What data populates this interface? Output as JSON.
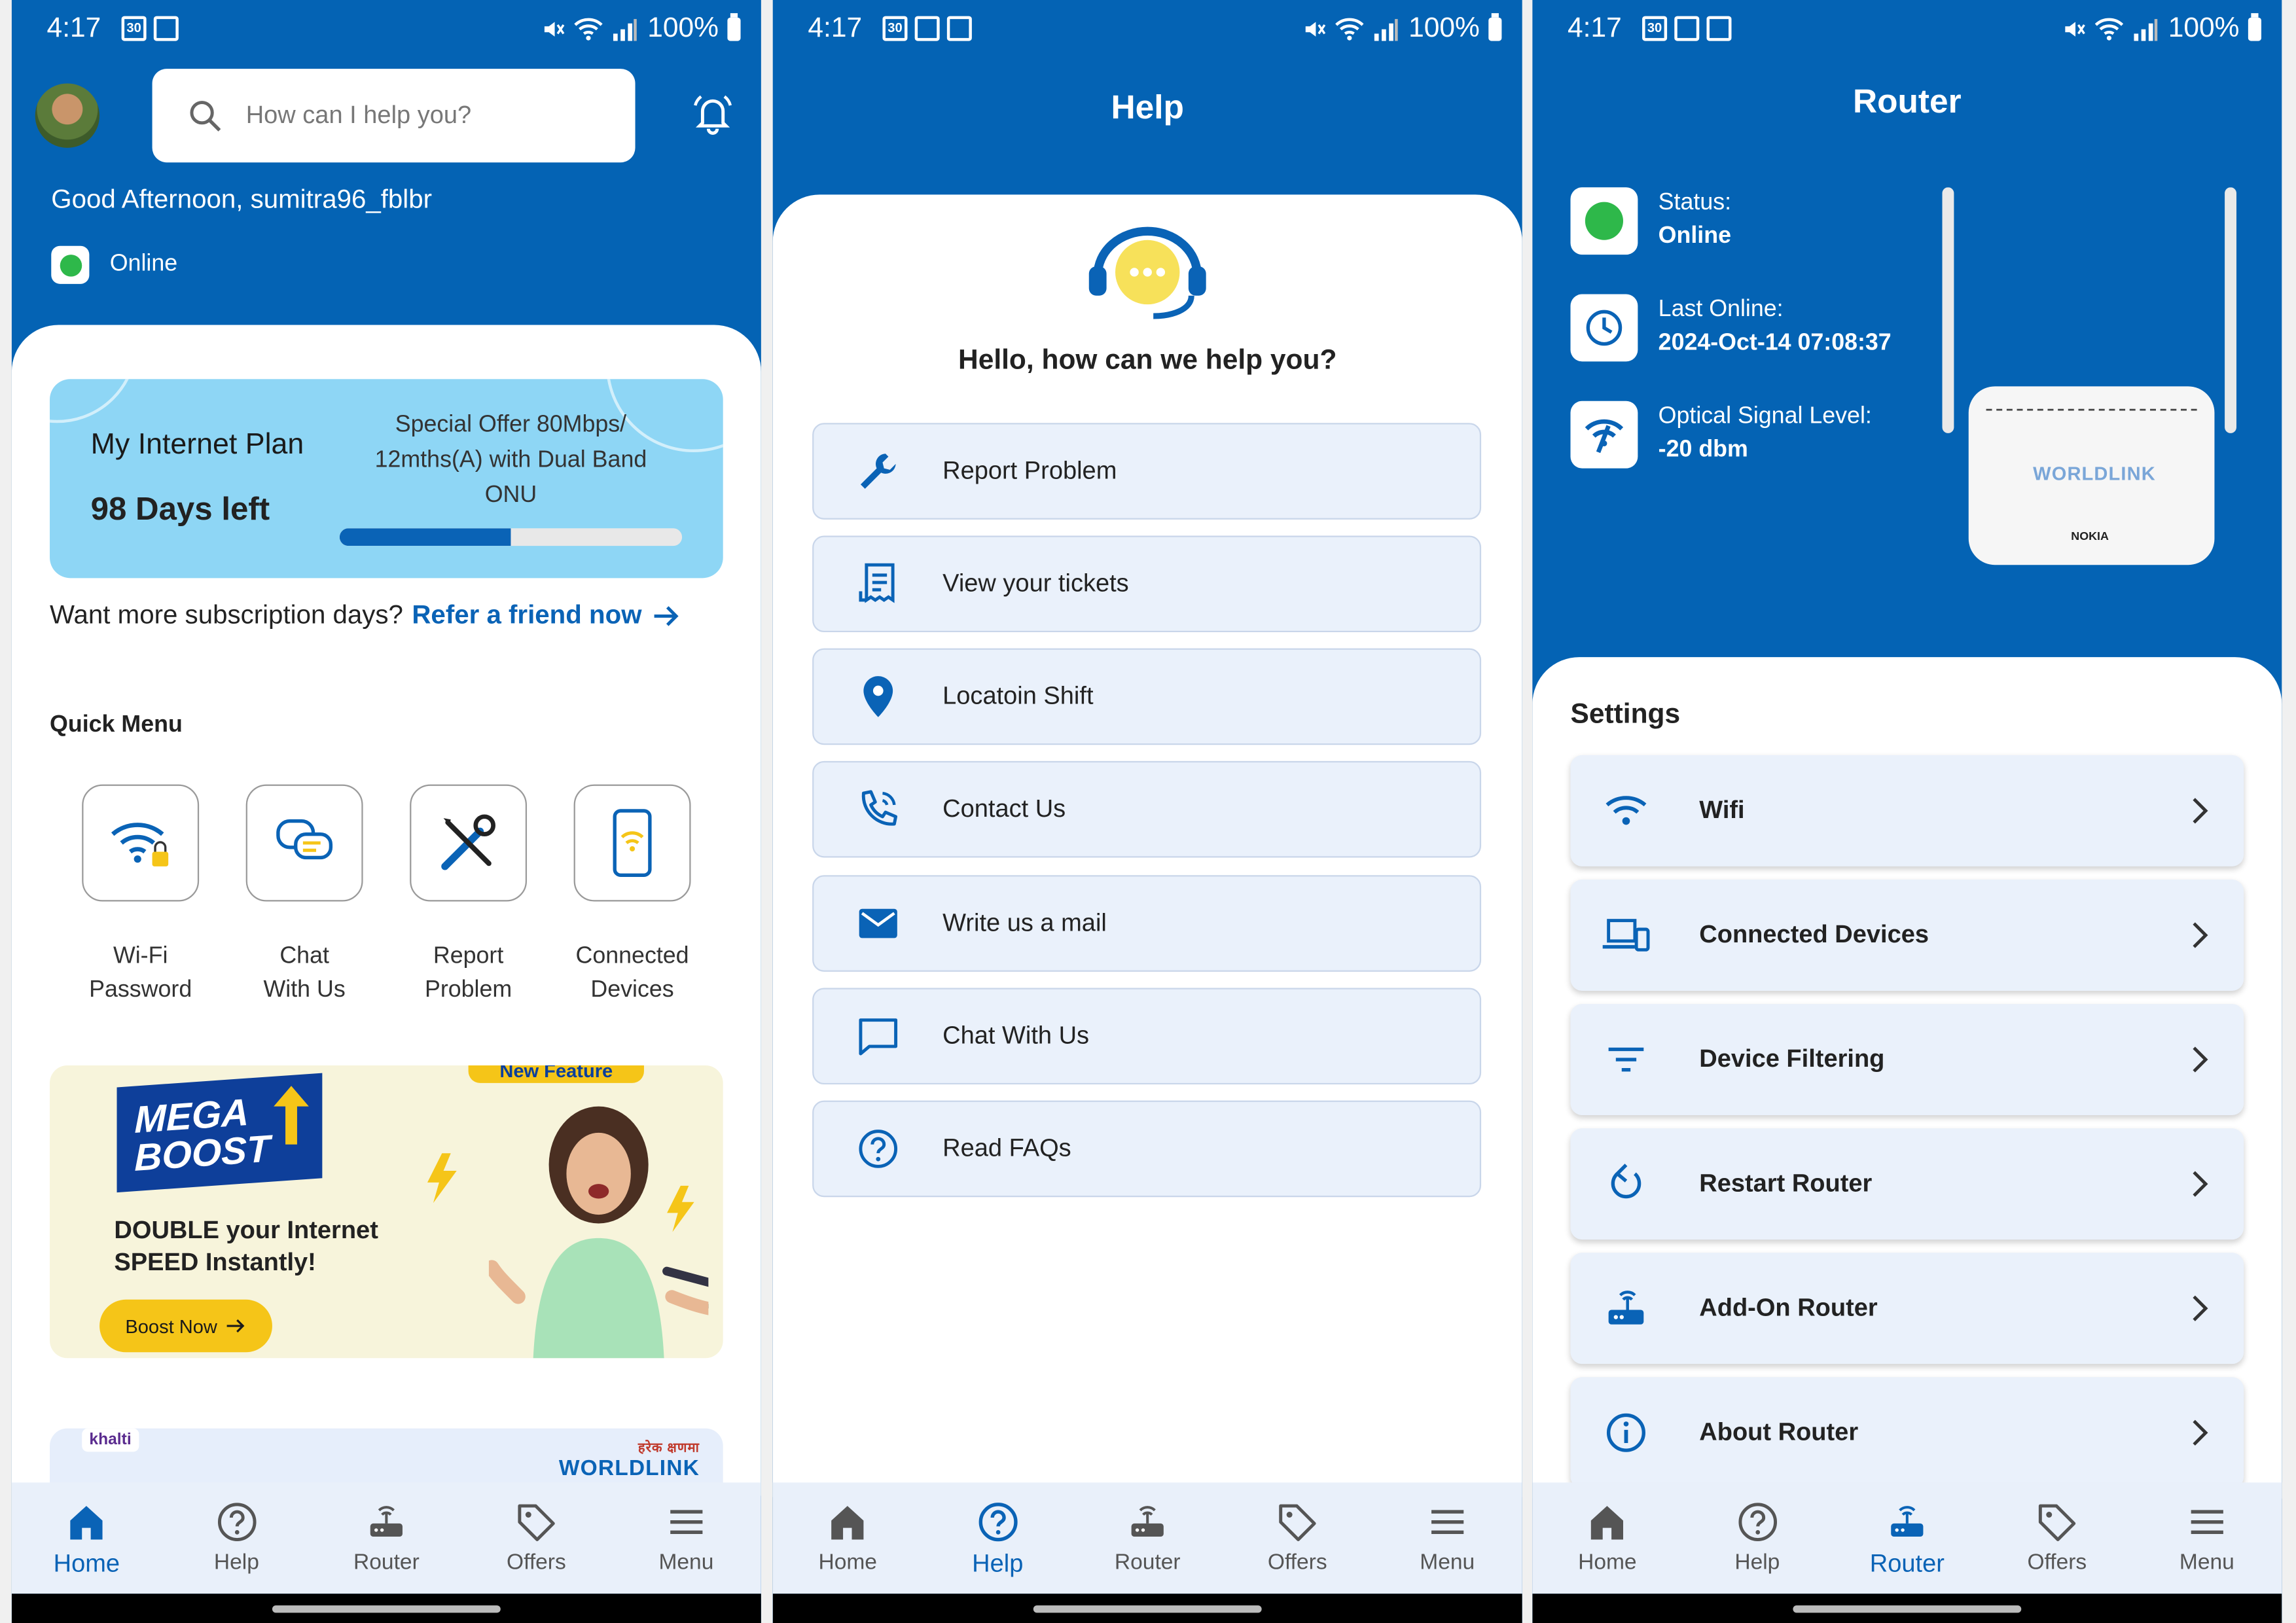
{
  "status_bar": {
    "time": "4:17",
    "battery": "100%",
    "mini_icon_label": "30"
  },
  "colors": {
    "primary": "#0463b4",
    "accent": "#0a63b6",
    "online_dot": "#2eb84a",
    "card_bg": "#eaf1fb",
    "banner_yellow": "#f5c518"
  },
  "home": {
    "search_placeholder": "How can I help you?",
    "greeting": "Good Afternoon, sumitra96_fblbr",
    "status": "Online",
    "plan": {
      "label": "My Internet Plan",
      "days_left": "98 Days left",
      "offer": "Special Offer 80Mbps/ 12mths(A) with Dual Band ONU",
      "progress": 0.5
    },
    "refer_text": "Want more subscription days?",
    "refer_link": "Refer a friend now",
    "quick_menu_title": "Quick Menu",
    "quick_menu": [
      {
        "label_1": "Wi-Fi",
        "label_2": "Password",
        "icon": "wifi-lock-icon"
      },
      {
        "label_1": "Chat",
        "label_2": "With Us",
        "icon": "chat-icon"
      },
      {
        "label_1": "Report",
        "label_2": "Problem",
        "icon": "tools-icon"
      },
      {
        "label_1": "Connected",
        "label_2": "Devices",
        "icon": "phone-wifi-icon"
      }
    ],
    "banner": {
      "tag": "New Feature",
      "mega_1": "MEGA",
      "mega_2": "BOOST",
      "headline_1": "DOUBLE your Internet",
      "headline_2": "SPEED Instantly!",
      "button": "Boost Now"
    },
    "banner2": {
      "khalti": "khalti",
      "brand_np": "हरेक क्षणमा",
      "brand": "WORLDLINK"
    }
  },
  "help": {
    "title": "Help",
    "hello": "Hello, how can we help you?",
    "items": [
      {
        "label": "Report Problem",
        "icon": "wrench-icon"
      },
      {
        "label": "View your tickets",
        "icon": "receipt-icon"
      },
      {
        "label": "Locatoin Shift",
        "icon": "location-pin-icon"
      },
      {
        "label": "Contact Us",
        "icon": "phone-call-icon"
      },
      {
        "label": "Write us a mail",
        "icon": "mail-icon"
      },
      {
        "label": "Chat With Us",
        "icon": "chat-bubble-icon"
      },
      {
        "label": "Read FAQs",
        "icon": "question-icon"
      }
    ]
  },
  "router": {
    "title": "Router",
    "status_label": "Status:",
    "status_value": "Online",
    "last_online_label": "Last Online:",
    "last_online_value": "2024-Oct-14 07:08:37",
    "signal_label": "Optical Signal Level:",
    "signal_value": "-20 dbm",
    "device_brand": "WORLDLINK",
    "device_maker": "NOKIA",
    "settings_title": "Settings",
    "settings": [
      {
        "label": "Wifi",
        "icon": "wifi-icon"
      },
      {
        "label": "Connected Devices",
        "icon": "devices-icon"
      },
      {
        "label": "Device Filtering",
        "icon": "filter-icon"
      },
      {
        "label": "Restart Router",
        "icon": "restart-icon"
      },
      {
        "label": "Add-On Router",
        "icon": "router-icon"
      },
      {
        "label": "About Router",
        "icon": "info-icon"
      }
    ]
  },
  "nav": {
    "items": [
      {
        "label": "Home",
        "icon": "home-icon"
      },
      {
        "label": "Help",
        "icon": "help-icon"
      },
      {
        "label": "Router",
        "icon": "router-icon"
      },
      {
        "label": "Offers",
        "icon": "tag-icon"
      },
      {
        "label": "Menu",
        "icon": "menu-icon"
      }
    ]
  }
}
